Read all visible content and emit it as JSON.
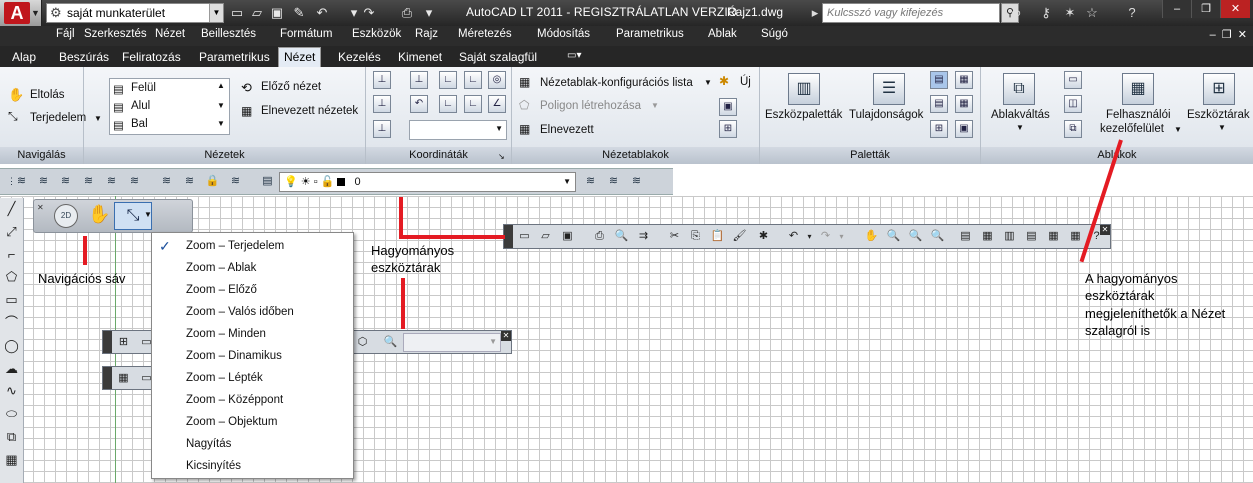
{
  "titlebar": {
    "workspace": "saját munkaterület",
    "app_title": "AutoCAD LT 2011 - REGISZTRÁLATLAN VERZIÓ",
    "document": "Rajz1.dwg",
    "search_placeholder": "Kulcsszó vagy kifejezés"
  },
  "menubar": [
    "Fájl",
    "Szerkesztés",
    "Nézet",
    "Beillesztés",
    "Formátum",
    "Eszközök",
    "Rajz",
    "Méretezés",
    "Módosítás",
    "Parametrikus",
    "Ablak",
    "Súgó"
  ],
  "ribbon_tabs": [
    "Alap",
    "Beszúrás",
    "Feliratozás",
    "Parametrikus",
    "Nézet",
    "Kezelés",
    "Kimenet",
    "Saját szalagfül"
  ],
  "ribbon_active_tab": "Nézet",
  "panels": {
    "navigation": {
      "title": "Navigálás",
      "pan": "Eltolás",
      "extents": "Terjedelem"
    },
    "views": {
      "title": "Nézetek",
      "list": [
        "Felül",
        "Alul",
        "Bal"
      ],
      "previous": "Előző nézet",
      "named": "Elnevezett nézetek"
    },
    "coordinates": {
      "title": "Koordináták"
    },
    "viewports": {
      "title": "Nézetablakok",
      "config": "Nézetablak-konfigurációs lista",
      "polygon": "Poligon létrehozása",
      "named": "Elnevezett",
      "new": "Új"
    },
    "palettes": {
      "title": "Paletták",
      "tool_palettes": "Eszközpaletták",
      "properties": "Tulajdonságok"
    },
    "windows": {
      "title": "Ablakok",
      "switch": "Ablakváltás",
      "ui1": "Felhasználói",
      "ui2": "kezelőfelület",
      "toolbars": "Eszköztárak"
    }
  },
  "layer": {
    "current": "0"
  },
  "zoom_menu": {
    "checked": "Zoom – Terjedelem",
    "items": [
      "Zoom – Terjedelem",
      "Zoom – Ablak",
      "Zoom – Előző",
      "Zoom – Valós időben",
      "Zoom – Minden",
      "Zoom – Dinamikus",
      "Zoom – Lépték",
      "Zoom – Középpont",
      "Zoom – Objektum",
      "Nagyítás",
      "Kicsinyítés"
    ]
  },
  "annotations": {
    "nav_bar": "Navigációs sáv",
    "classic1": "Hagyományos",
    "classic2": "eszköztárak",
    "ribbon_note1": "A hagyományos",
    "ribbon_note2": "eszköztárak",
    "ribbon_note3": "megjeleníthetők a Nézet",
    "ribbon_note4": "szalagról is"
  },
  "colors": {
    "accent_red": "#e41b23",
    "titlebar": "#333333",
    "ribbon": "#e4e9f0",
    "grid": "#c9c9c9"
  }
}
